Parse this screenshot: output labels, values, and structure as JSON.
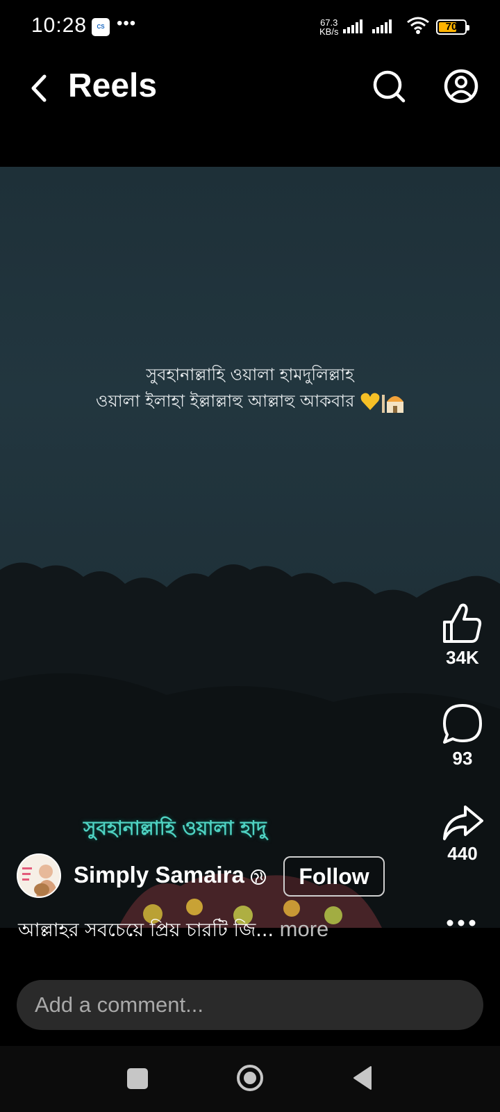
{
  "status_bar": {
    "time": "10:28",
    "app_icon_text": "CS",
    "overflow": "•••",
    "speed_value": "67.3",
    "speed_unit": "KB/s",
    "battery": "70",
    "battery_level": 0.7,
    "battery_color": "#ffb300"
  },
  "header": {
    "title": "Reels",
    "back_icon": "chevron-left-icon",
    "search_icon": "search-icon",
    "profile_icon": "user-circle-icon"
  },
  "video": {
    "text_line_1": "সুবহানাল্লাহি ওয়ালা হামদুলিল্লাহ",
    "text_line_2": "ওয়ালা ইলাহা ইল্লাল্লাহু আল্লাহু আকবার",
    "overlay_caption": "সুবহানাল্লাহি ওয়ালা হাদু"
  },
  "actions": {
    "likes": "34K",
    "comments": "93",
    "shares": "440"
  },
  "creator": {
    "name": "Simply Samaira",
    "follow_label": "Follow"
  },
  "caption": {
    "text": "আল্লাহর সবচেয়ে প্রিয় চারটি জি...",
    "more": " more"
  },
  "comment": {
    "placeholder": "Add a comment..."
  },
  "colors": {
    "accent_overlay_text": "#4fd2c2",
    "heart": "#f6c026"
  }
}
